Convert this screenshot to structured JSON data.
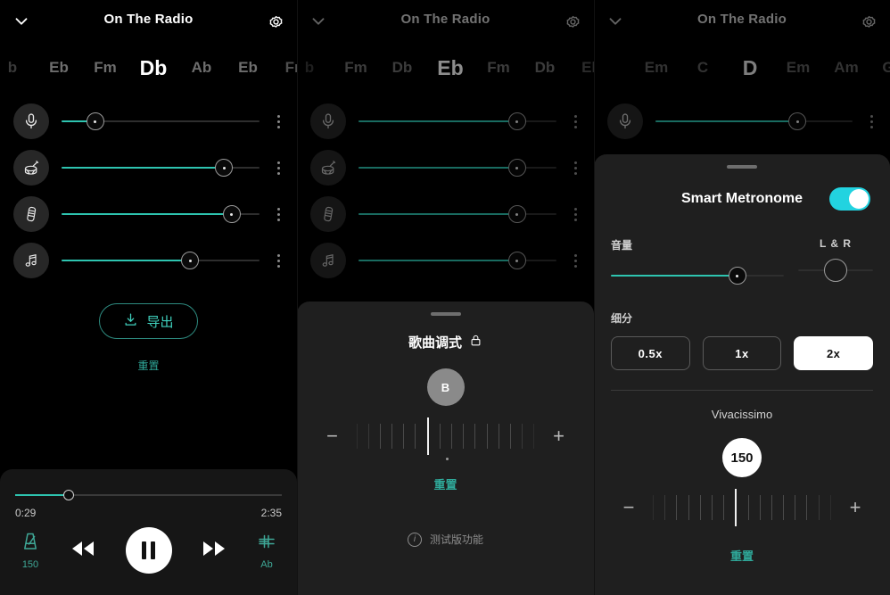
{
  "app": {
    "accent_teal": "#2ec4b0",
    "accent_cyan": "#22d3e0",
    "background": "#000000",
    "sheet_background": "#1f1f1f"
  },
  "panel1": {
    "header": {
      "title": "On The Radio",
      "collapse_icon": "chevron-down-icon",
      "settings_icon": "gear-icon"
    },
    "chords": [
      {
        "label": "b",
        "state": "cut"
      },
      {
        "label": "Eb",
        "state": "normal"
      },
      {
        "label": "Fm",
        "state": "normal"
      },
      {
        "label": "Db",
        "state": "active"
      },
      {
        "label": "Ab",
        "state": "normal"
      },
      {
        "label": "Eb",
        "state": "normal"
      },
      {
        "label": "Fn",
        "state": "cut"
      }
    ],
    "tracks": [
      {
        "name": "Vocals",
        "icon": "microphone-icon",
        "volume": 17
      },
      {
        "name": "Drums",
        "icon": "drum-icon",
        "volume": 82
      },
      {
        "name": "Bass",
        "icon": "guitar-fretboard-icon",
        "volume": 86
      },
      {
        "name": "Other",
        "icon": "music-note-icon",
        "volume": 65
      }
    ],
    "export_label": "导出",
    "export_icon": "download-icon",
    "reset_label": "重置",
    "player": {
      "elapsed": "0:29",
      "duration": "2:35",
      "progress": 20,
      "metronome_icon": "metronome-icon",
      "bpm": "150",
      "rewind_icon": "rewind-icon",
      "play_state_icon": "pause-icon",
      "forward_icon": "fast-forward-icon",
      "pitch_icon": "pitch-shift-icon",
      "pitch_label": "Ab"
    }
  },
  "panel2": {
    "header": {
      "title": "On The Radio",
      "collapse_icon": "chevron-down-icon",
      "settings_icon": "gear-icon"
    },
    "chords": [
      {
        "label": "b",
        "state": "cut"
      },
      {
        "label": "Fm",
        "state": "normal"
      },
      {
        "label": "Db",
        "state": "normal"
      },
      {
        "label": "Eb",
        "state": "active"
      },
      {
        "label": "Fm",
        "state": "normal"
      },
      {
        "label": "Db",
        "state": "normal"
      },
      {
        "label": "Eb",
        "state": "cut"
      }
    ],
    "tracks": [
      {
        "name": "Vocals",
        "icon": "microphone-icon",
        "volume": 80
      },
      {
        "name": "Drums",
        "icon": "drum-icon",
        "volume": 80
      },
      {
        "name": "Bass",
        "icon": "guitar-fretboard-icon",
        "volume": 80
      },
      {
        "name": "Other",
        "icon": "music-note-icon",
        "volume": 80
      }
    ],
    "key_sheet": {
      "title": "歌曲调式",
      "lock_icon": "lock-icon",
      "value": "B",
      "minus_label": "−",
      "plus_label": "+",
      "reset_label": "重置",
      "beta_label": "测试版功能",
      "info_icon": "info-icon"
    }
  },
  "panel3": {
    "header": {
      "title": "On The Radio",
      "collapse_icon": "chevron-down-icon",
      "settings_icon": "gear-icon"
    },
    "chords": [
      {
        "label": "Em",
        "state": "normal"
      },
      {
        "label": "C",
        "state": "normal"
      },
      {
        "label": "D",
        "state": "active"
      },
      {
        "label": "Em",
        "state": "normal"
      },
      {
        "label": "Am",
        "state": "normal"
      },
      {
        "label": "G",
        "state": "cut"
      }
    ],
    "tracks": [
      {
        "name": "Vocals",
        "icon": "microphone-icon",
        "volume": 72
      }
    ],
    "metronome_sheet": {
      "title": "Smart Metronome",
      "enabled": true,
      "volume_label": "音量",
      "volume": 73,
      "pan_label": "L & R",
      "pan": 50,
      "subdivision_label": "细分",
      "subdivisions": [
        {
          "label": "0.5x",
          "selected": false
        },
        {
          "label": "1x",
          "selected": false
        },
        {
          "label": "2x",
          "selected": true
        }
      ],
      "tempo_name": "Vivacissimo",
      "bpm": "150",
      "minus_label": "−",
      "plus_label": "+",
      "reset_label": "重置"
    }
  }
}
